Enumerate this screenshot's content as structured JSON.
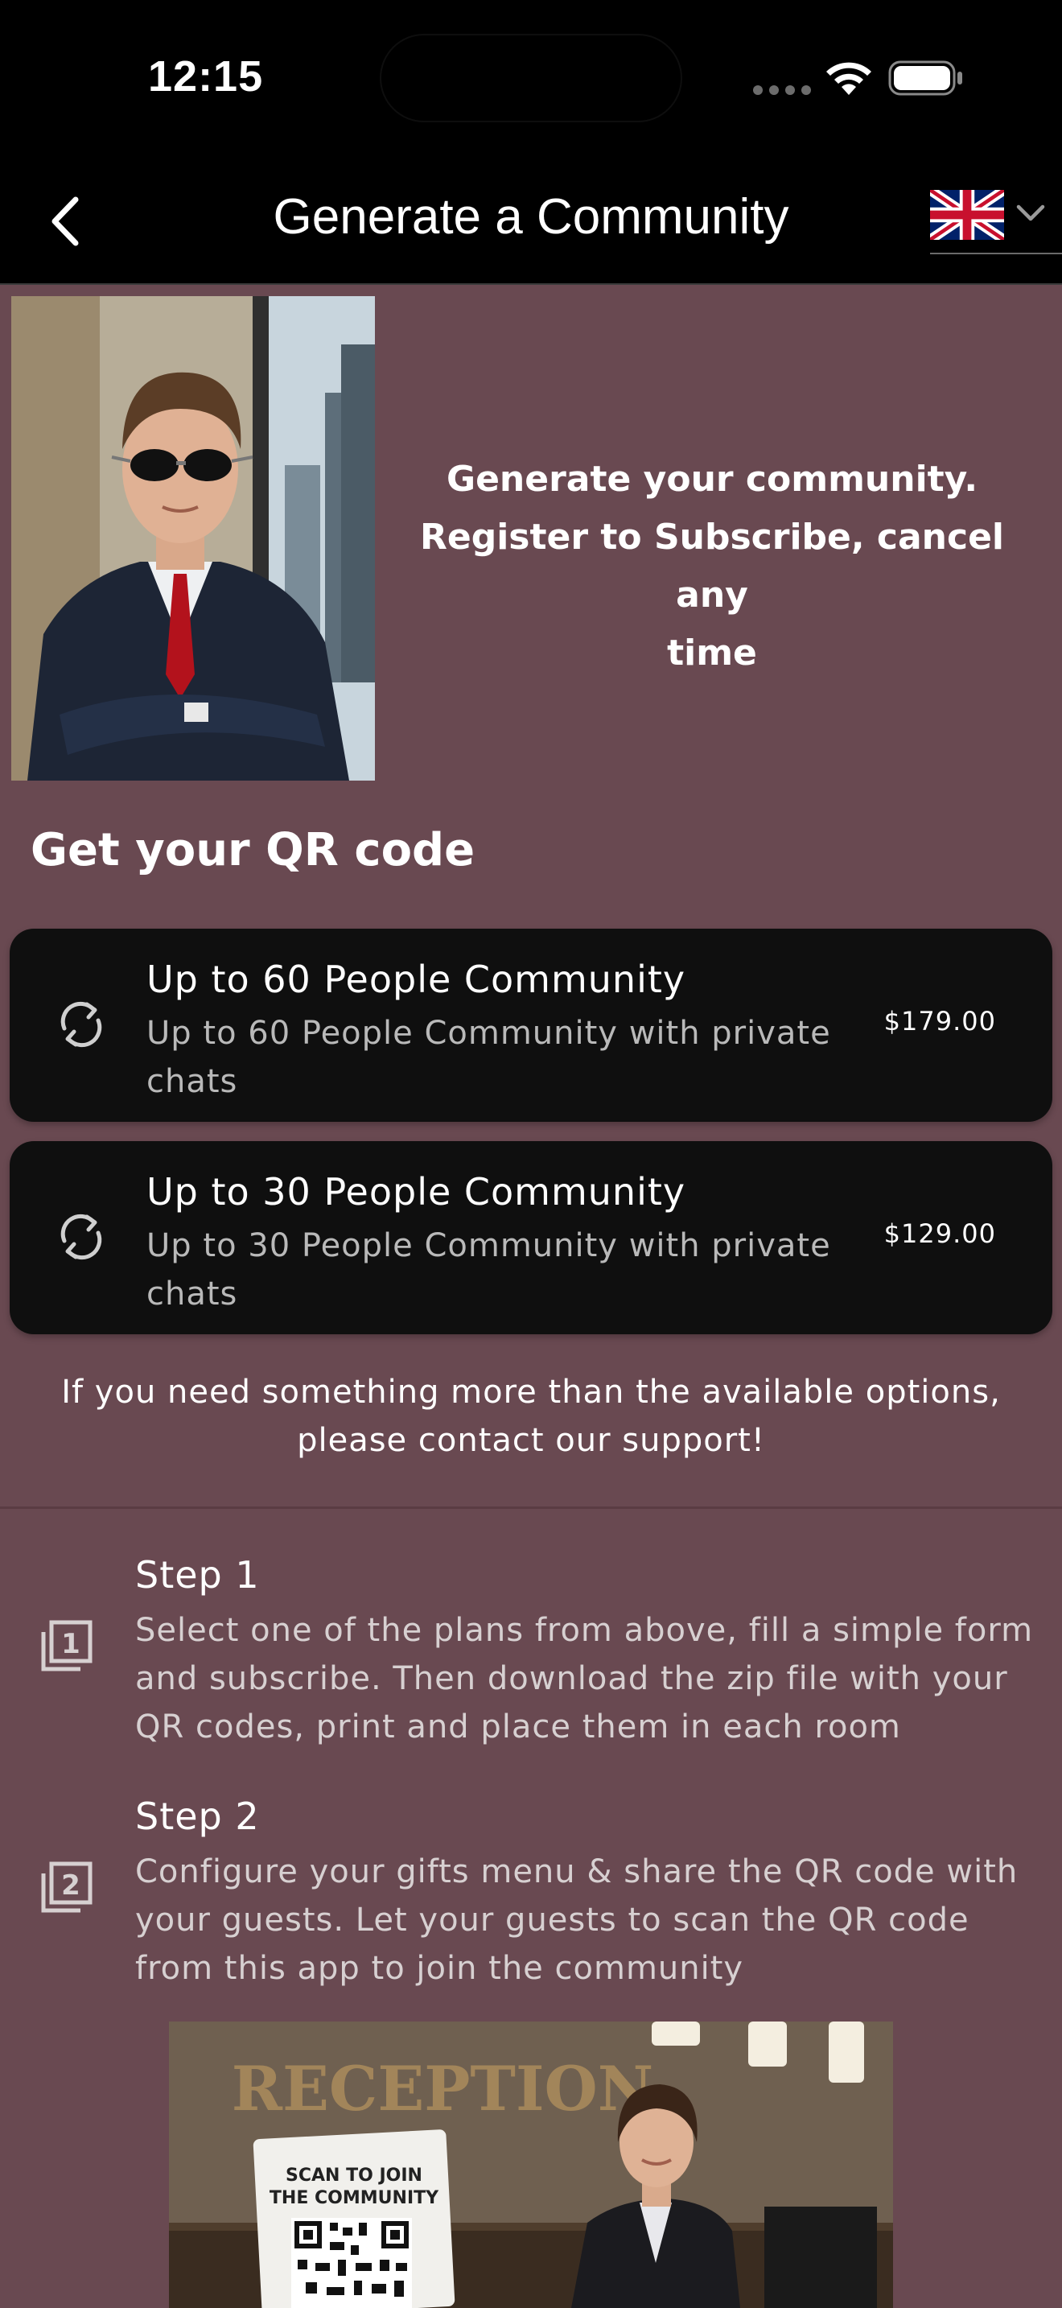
{
  "status_bar": {
    "time": "12:15"
  },
  "app_bar": {
    "title": "Generate a Community",
    "back_icon": "chevron-left-icon",
    "language_flag": "uk-flag-icon"
  },
  "hero": {
    "tagline_line1": "Generate your community.",
    "tagline_line2": "Register to Subscribe, cancel any",
    "tagline_line3": "time"
  },
  "qr_section": {
    "title": "Get your QR code"
  },
  "plans": [
    {
      "title": "Up to 60 People Community",
      "description": "Up to 60 People Community with private chats",
      "price": "$179.00",
      "icon": "refresh-icon"
    },
    {
      "title": "Up to 30 People Community",
      "description": "Up to 30 People Community with private chats",
      "price": "$129.00",
      "icon": "refresh-icon"
    }
  ],
  "support_note": "If you need something more than the available options, please contact our support!",
  "steps": [
    {
      "title": "Step 1",
      "description": "Select one of the plans from above, fill a simple form and subscribe. Then download the zip file with your QR codes, print and place them in each room",
      "icon": "step-1-icon"
    },
    {
      "title": "Step 2",
      "description": "Configure your gifts menu & share the QR code with your guests. Let your guests to scan the QR code from this app to join the community",
      "icon": "step-2-icon"
    }
  ],
  "reception_image": {
    "sign_text": "RECEPTION",
    "card_text_line1": "SCAN TO JOIN",
    "card_text_line2": "THE COMMUNITY"
  },
  "colors": {
    "background": "#694951",
    "bar": "#000000",
    "card": "#0f0f0f",
    "muted_text": "#b9b9b9"
  }
}
